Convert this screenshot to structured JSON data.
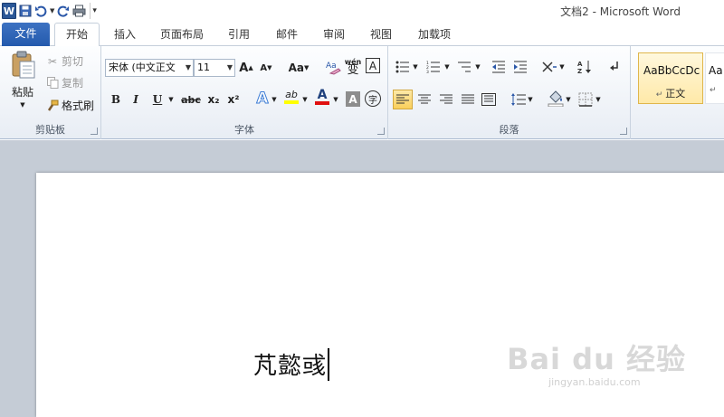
{
  "window": {
    "title": "文档2 - Microsoft Word"
  },
  "quick_access": {
    "icons": [
      "word-logo-icon",
      "save-icon",
      "undo-icon",
      "undo-dropdown-icon",
      "redo-icon",
      "print-preview-icon",
      "customize-qat-icon"
    ],
    "logo_letter": "W"
  },
  "tabs": [
    {
      "label": "文件"
    },
    {
      "label": "开始"
    },
    {
      "label": "插入"
    },
    {
      "label": "页面布局"
    },
    {
      "label": "引用"
    },
    {
      "label": "邮件"
    },
    {
      "label": "审阅"
    },
    {
      "label": "视图"
    },
    {
      "label": "加载项"
    }
  ],
  "clipboard": {
    "group_label": "剪贴板",
    "paste": "粘贴",
    "cut": "剪切",
    "copy": "复制",
    "format_painter": "格式刷"
  },
  "font": {
    "group_label": "字体",
    "font_name": "宋体 (中文正文",
    "font_size": "11",
    "change_case": "Aa",
    "phonetic_guide": "wén",
    "phonetic_char": "变",
    "border_char": "A",
    "bold": "B",
    "italic": "I",
    "underline": "U",
    "strikethrough": "abc",
    "subscript": "x₂",
    "superscript": "x²",
    "text_effects": "A",
    "highlight": "ab",
    "font_color": "A",
    "shading_char": "A",
    "enclose_char": "字",
    "grow": "A",
    "shrink": "A"
  },
  "paragraph": {
    "group_label": "段落"
  },
  "styles": {
    "items": [
      {
        "preview": "AaBbCcDc",
        "name": "正文"
      },
      {
        "preview": "Aa",
        "name": ""
      }
    ]
  },
  "document": {
    "text": "芃懿彧"
  },
  "watermark": {
    "brand": "Bai du 经验",
    "url": "jingyan.baidu.com"
  },
  "colors": {
    "file_tab": "#2b5fb0",
    "highlight": "#ffff00",
    "font_color_bar": "#e01010",
    "page_bg": "#c5ccd6"
  }
}
